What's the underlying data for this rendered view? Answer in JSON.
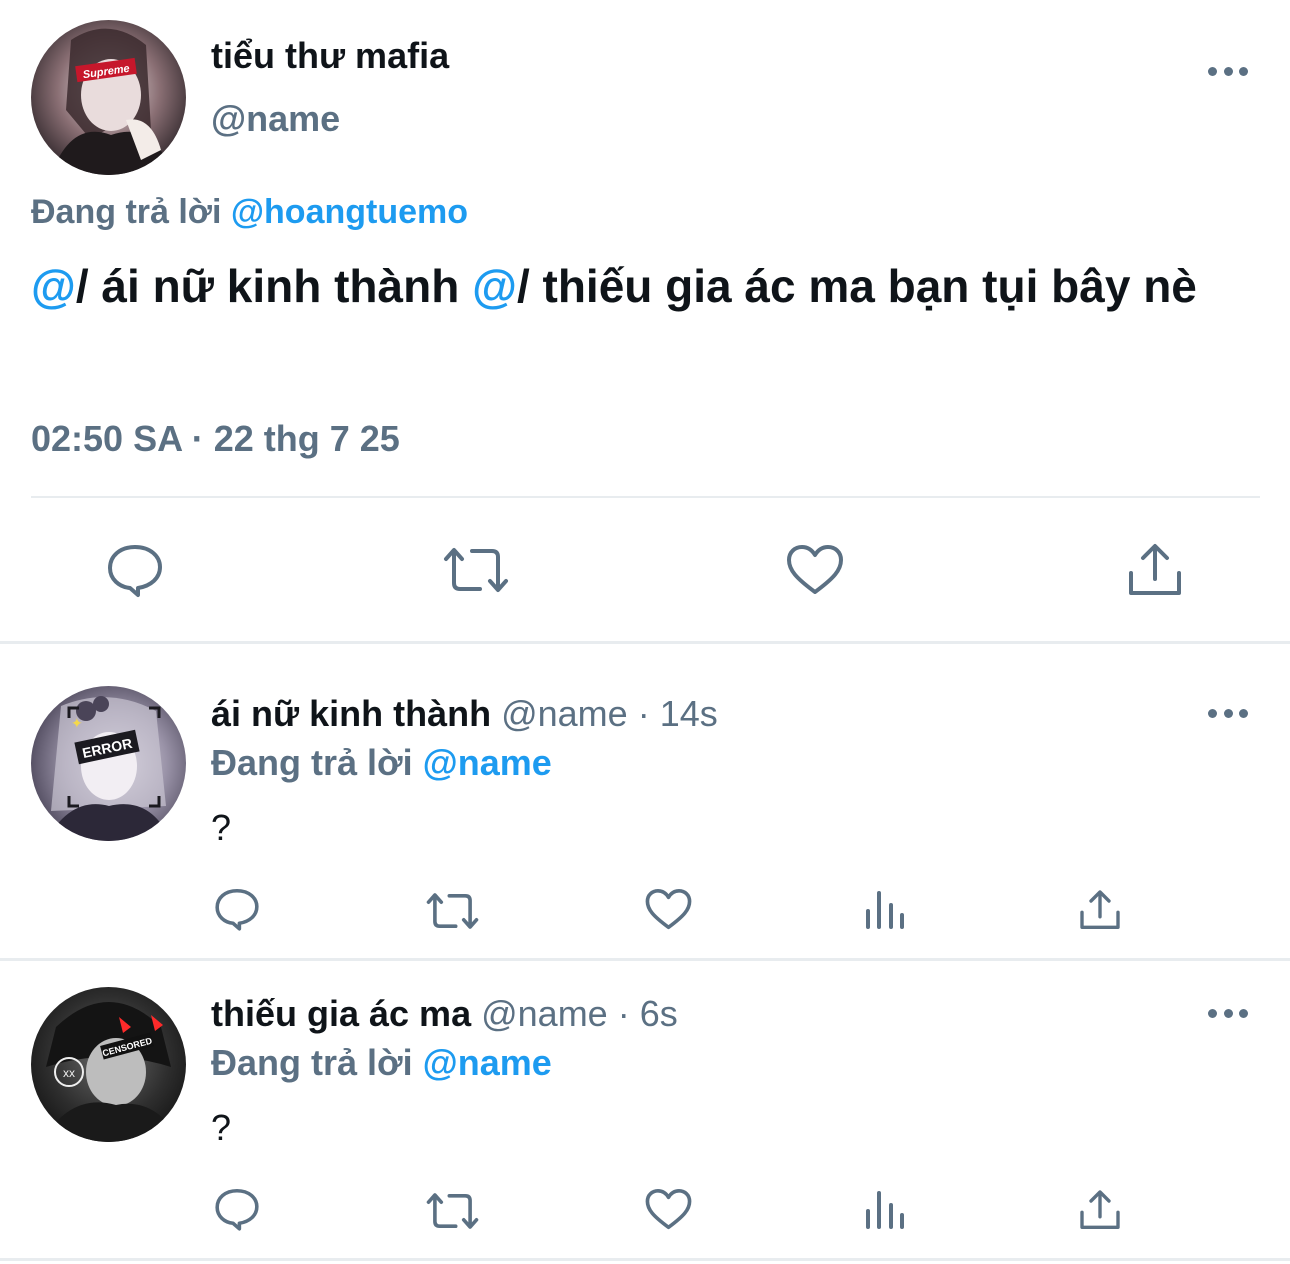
{
  "main_tweet": {
    "display_name": "tiểu thư mafia",
    "handle": "@name",
    "replying_prefix": "Đang trả lời",
    "replying_to": "@hoangtuemo",
    "text": {
      "mention1": "@",
      "part1": "/ ái nữ kinh thành ",
      "mention2": "@",
      "part2": "/ thiếu gia ác ma bạn tụi bây nè"
    },
    "timestamp": "02:50 SA · 22 thg 7 25",
    "avatar_badge": "Supreme"
  },
  "replies": [
    {
      "display_name": "ái nữ kinh thành",
      "handle": "@name",
      "time": "· 14s",
      "replying_prefix": "Đang trả lời",
      "replying_to": "@name",
      "text": "?",
      "avatar_badge": "ERROR"
    },
    {
      "display_name": "thiếu gia ác ma",
      "handle": "@name",
      "time": "· 6s",
      "replying_prefix": "Đang trả lời",
      "replying_to": "@name",
      "text": "?",
      "avatar_badge": "CENSORED"
    }
  ],
  "icons": {
    "reply": "reply-icon",
    "retweet": "retweet-icon",
    "like": "like-icon",
    "analytics": "analytics-icon",
    "share": "share-icon",
    "more": "more-icon"
  },
  "colors": {
    "text": "#0f1419",
    "secondary": "#5b7083",
    "link": "#1d9bf0",
    "divider": "#e8ecef"
  }
}
